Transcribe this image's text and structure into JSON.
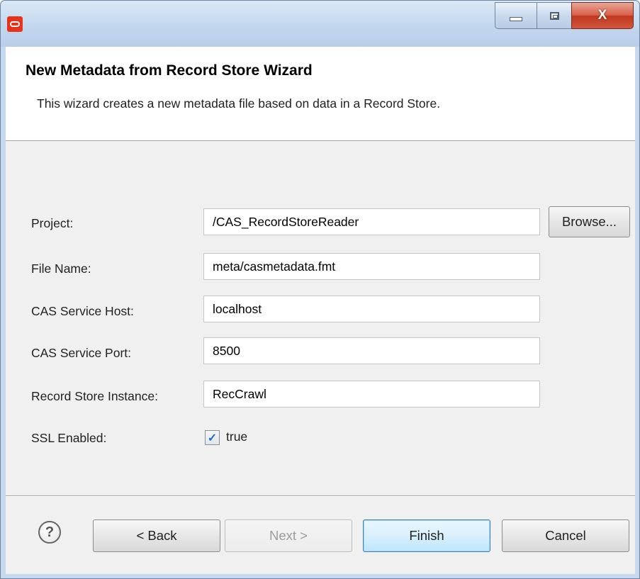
{
  "window": {
    "controls": {
      "minimize_icon": "minimize-icon",
      "maximize_icon": "maximize-icon",
      "close_icon": "close-icon",
      "close_glyph": "X"
    },
    "app_icon": "oracle-logo-icon"
  },
  "header": {
    "title": "New Metadata from Record Store Wizard",
    "description": "This wizard creates a new metadata file based on data in a Record Store."
  },
  "form": {
    "project": {
      "label": "Project:",
      "value": "/CAS_RecordStoreReader",
      "browse_label": "Browse..."
    },
    "file_name": {
      "label": "File Name:",
      "value": "meta/casmetadata.fmt"
    },
    "host": {
      "label": "CAS Service Host:",
      "value": "localhost"
    },
    "port": {
      "label": "CAS Service Port:",
      "value": "8500"
    },
    "instance": {
      "label": "Record Store Instance:",
      "value": "RecCrawl"
    },
    "ssl": {
      "label": "SSL Enabled:",
      "checked": true,
      "check_mark": "✓",
      "checkbox_label": "true"
    }
  },
  "footer": {
    "help_glyph": "?",
    "back": "< Back",
    "next": "Next >",
    "finish": "Finish",
    "cancel": "Cancel"
  },
  "colors": {
    "title_bar": "#c3d7ee",
    "close_button": "#c0381f",
    "default_button_border": "#3c7fb1",
    "app_icon": "#e8321a"
  }
}
